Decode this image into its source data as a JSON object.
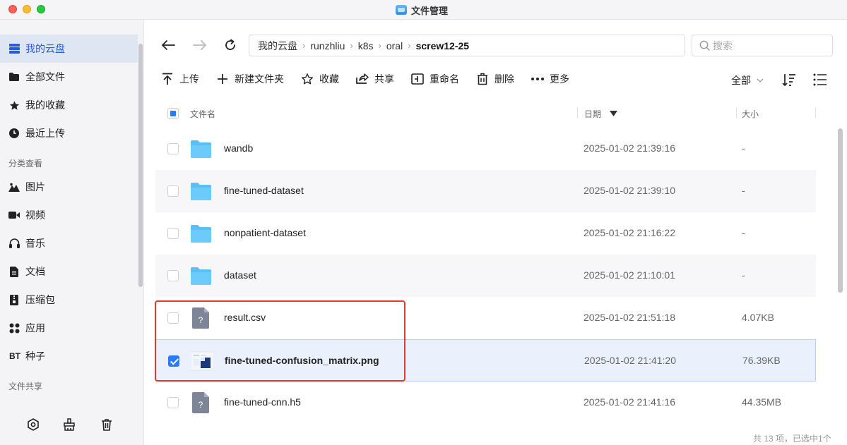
{
  "window": {
    "title": "文件管理"
  },
  "sidebar": {
    "items": [
      {
        "label": "我的云盘",
        "icon": "storage-icon"
      },
      {
        "label": "全部文件",
        "icon": "folder-icon"
      },
      {
        "label": "我的收藏",
        "icon": "star-icon"
      },
      {
        "label": "最近上传",
        "icon": "clock-icon"
      }
    ],
    "section_category": "分类查看",
    "category_items": [
      {
        "label": "图片",
        "icon": "mountain-icon"
      },
      {
        "label": "视频",
        "icon": "video-icon"
      },
      {
        "label": "音乐",
        "icon": "headphones-icon"
      },
      {
        "label": "文档",
        "icon": "document-icon"
      },
      {
        "label": "压缩包",
        "icon": "archive-icon"
      },
      {
        "label": "应用",
        "icon": "apps-icon"
      },
      {
        "label": "种子",
        "icon_text": "BT"
      }
    ],
    "section_share": "文件共享"
  },
  "breadcrumb": [
    "我的云盘",
    "runzhliu",
    "k8s",
    "oral",
    "screw12-25"
  ],
  "search": {
    "placeholder": "搜索"
  },
  "actions": [
    {
      "label": "上传",
      "icon": "upload-icon"
    },
    {
      "label": "新建文件夹",
      "icon": "plus-icon"
    },
    {
      "label": "收藏",
      "icon": "star-outline-icon"
    },
    {
      "label": "共享",
      "icon": "share-icon"
    },
    {
      "label": "重命名",
      "icon": "rename-icon"
    },
    {
      "label": "删除",
      "icon": "trash-icon"
    },
    {
      "label": "更多",
      "icon": "more-icon"
    }
  ],
  "filter": {
    "label": "全部"
  },
  "table": {
    "columns": {
      "name": "文件名",
      "date": "日期",
      "size": "大小"
    },
    "rows": [
      {
        "name": "wandb",
        "date": "2025-01-02 21:39:16",
        "size": "-",
        "type": "folder"
      },
      {
        "name": "fine-tuned-dataset",
        "date": "2025-01-02 21:39:10",
        "size": "-",
        "type": "folder"
      },
      {
        "name": "nonpatient-dataset",
        "date": "2025-01-02 21:16:22",
        "size": "-",
        "type": "folder"
      },
      {
        "name": "dataset",
        "date": "2025-01-02 21:10:01",
        "size": "-",
        "type": "folder"
      },
      {
        "name": "result.csv",
        "date": "2025-01-02 21:51:18",
        "size": "4.07KB",
        "type": "unknown"
      },
      {
        "name": "fine-tuned-confusion_matrix.png",
        "date": "2025-01-02 21:41:20",
        "size": "76.39KB",
        "type": "image",
        "selected": true
      },
      {
        "name": "fine-tuned-cnn.h5",
        "date": "2025-01-02 21:41:16",
        "size": "44.35MB",
        "type": "unknown"
      }
    ]
  },
  "footer": {
    "status": "共 13 项，已选中1个"
  },
  "colors": {
    "accent": "#2a7bf6",
    "highlight": "#e33a2e",
    "folder": "#5cbef7"
  }
}
